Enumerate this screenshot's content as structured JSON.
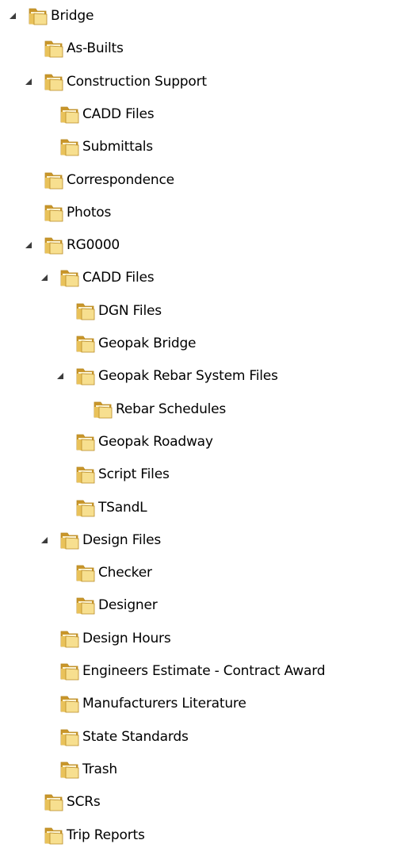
{
  "tree": [
    {
      "label": "Bridge",
      "level": 0,
      "expanded": true,
      "icon": "folder-icon"
    },
    {
      "label": "As-Builts",
      "level": 1,
      "expanded": false,
      "icon": "folder-icon"
    },
    {
      "label": "Construction Support",
      "level": 1,
      "expanded": true,
      "icon": "folder-icon"
    },
    {
      "label": "CADD Files",
      "level": 2,
      "expanded": false,
      "icon": "folder-icon"
    },
    {
      "label": "Submittals",
      "level": 2,
      "expanded": false,
      "icon": "folder-icon"
    },
    {
      "label": "Correspondence",
      "level": 1,
      "expanded": false,
      "icon": "folder-icon"
    },
    {
      "label": "Photos",
      "level": 1,
      "expanded": false,
      "icon": "folder-icon"
    },
    {
      "label": "RG0000",
      "level": 1,
      "expanded": true,
      "icon": "folder-icon"
    },
    {
      "label": "CADD Files",
      "level": 2,
      "expanded": true,
      "icon": "folder-icon"
    },
    {
      "label": "DGN Files",
      "level": 3,
      "expanded": false,
      "icon": "folder-icon"
    },
    {
      "label": "Geopak Bridge",
      "level": 3,
      "expanded": false,
      "icon": "folder-icon"
    },
    {
      "label": "Geopak Rebar System Files",
      "level": 3,
      "expanded": true,
      "icon": "folder-icon"
    },
    {
      "label": "Rebar Schedules",
      "level": 4,
      "expanded": false,
      "icon": "folder-icon"
    },
    {
      "label": "Geopak Roadway",
      "level": 3,
      "expanded": false,
      "icon": "folder-icon"
    },
    {
      "label": "Script Files",
      "level": 3,
      "expanded": false,
      "icon": "folder-icon"
    },
    {
      "label": "TSandL",
      "level": 3,
      "expanded": false,
      "icon": "folder-icon"
    },
    {
      "label": "Design Files",
      "level": 2,
      "expanded": true,
      "icon": "folder-icon"
    },
    {
      "label": "Checker",
      "level": 3,
      "expanded": false,
      "icon": "folder-icon"
    },
    {
      "label": "Designer",
      "level": 3,
      "expanded": false,
      "icon": "folder-icon"
    },
    {
      "label": "Design Hours",
      "level": 2,
      "expanded": false,
      "icon": "folder-icon"
    },
    {
      "label": "Engineers Estimate -  Contract Award",
      "level": 2,
      "expanded": false,
      "icon": "folder-icon"
    },
    {
      "label": "Manufacturers Literature",
      "level": 2,
      "expanded": false,
      "icon": "folder-icon"
    },
    {
      "label": "State Standards",
      "level": 2,
      "expanded": false,
      "icon": "folder-icon"
    },
    {
      "label": "Trash",
      "level": 2,
      "expanded": false,
      "icon": "folder-icon"
    },
    {
      "label": "SCRs",
      "level": 1,
      "expanded": false,
      "icon": "folder-icon"
    },
    {
      "label": "Trip Reports",
      "level": 1,
      "expanded": false,
      "icon": "folder-icon"
    }
  ],
  "colors": {
    "folder_light": "#f7df8f",
    "folder_mid": "#e9c25a",
    "folder_dark": "#c9962a",
    "folder_edge": "#b98a25",
    "expander": "#3c3c3c",
    "text": "#000000"
  }
}
